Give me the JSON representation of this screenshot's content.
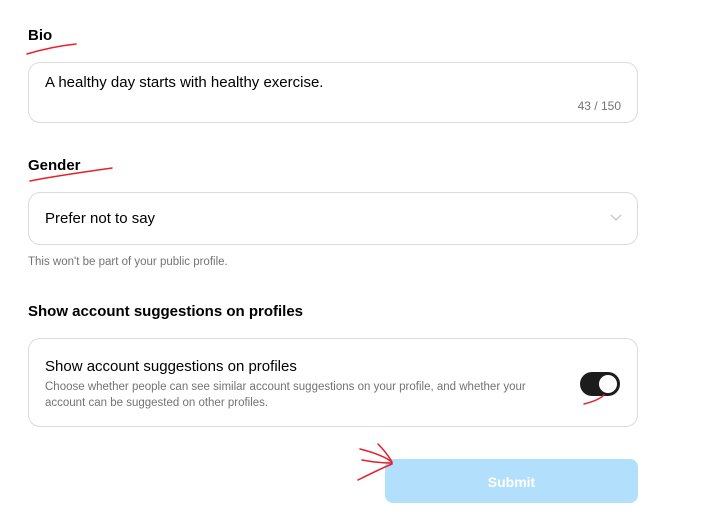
{
  "bio": {
    "heading": "Bio",
    "value": "A healthy day starts with healthy exercise.",
    "counter": "43 / 150"
  },
  "gender": {
    "heading": "Gender",
    "selected": "Prefer not to say",
    "note": "This won't be part of your public profile.",
    "icon": "chevron-down-icon"
  },
  "suggestions": {
    "heading": "Show account suggestions on profiles",
    "title": "Show account suggestions on profiles",
    "description": "Choose whether people can see similar account suggestions on your profile, and whether your account can be suggested on other profiles.",
    "toggle_on": true
  },
  "submit": {
    "label": "Submit"
  },
  "colors": {
    "annotation": "#e8202a",
    "toggle_on": "#1c1c1c",
    "submit_disabled": "#b2dffc",
    "muted_text": "#737373",
    "border": "#dbdbdb"
  }
}
